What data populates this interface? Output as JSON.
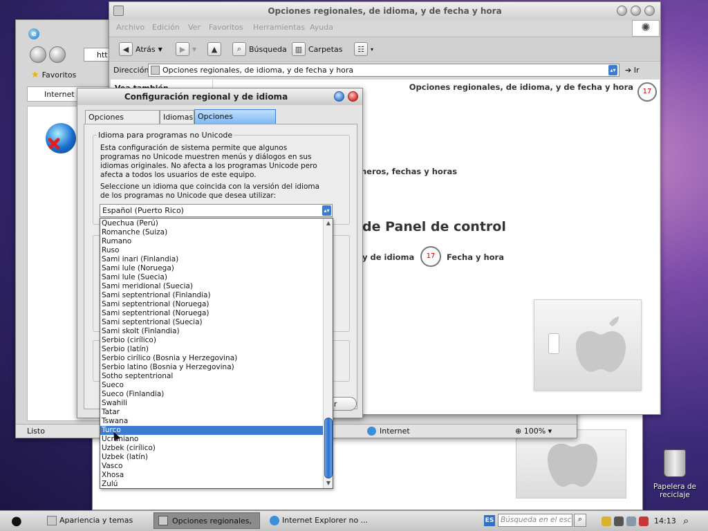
{
  "ie_window": {
    "address_partial": "htt",
    "favorites_label": "Favoritos",
    "tab_label": "Internet E",
    "status_left": "Listo",
    "zone": "Internet",
    "zoom": "100%"
  },
  "explorer": {
    "title": "Opciones regionales, de idioma, y de fecha y hora",
    "menu": [
      "Archivo",
      "Edición",
      "Ver",
      "Favoritos",
      "Herramientas",
      "Ayuda"
    ],
    "back_label": "Atrás",
    "search_label": "Búsqueda",
    "folders_label": "Carpetas",
    "address_label": "Dirección",
    "address_value": "Opciones regionales, de idioma, y de fecha y hora",
    "go_label": "Ir",
    "see_also": "Vea también",
    "header_title": "Opciones regionales, de idioma, y de fecha y hora",
    "task_text": "neros, fechas y horas",
    "panel_heading": "de Panel de control",
    "icon_lang_label": "y de idioma",
    "icon_date_label": "Fecha y hora"
  },
  "dialog": {
    "title": "Configuración regional y de idioma",
    "tabs": [
      "Opciones regionales",
      "Idiomas",
      "Opciones avanzadas"
    ],
    "group_title": "Idioma para programas no Unicode",
    "description": "Esta configuración de sistema permite que algunos programas no Unicode muestren menús y diálogos en sus idiomas originales. No afecta a los programas Unicode pero afecta a todos los usuarios de este equipo.",
    "prompt": "Seleccione un idioma que coincida con la versión del idioma de los programas no Unicode que desea utilizar:",
    "selected": "Español (Puerto Rico)",
    "options": [
      "Quechua (Perú)",
      "Romanche (Suiza)",
      "Rumano",
      "Ruso",
      "Sami inari (Finlandia)",
      "Sami lule (Noruega)",
      "Sami lule (Suecia)",
      "Sami meridional (Suecia)",
      "Sami septentrional (Finlandia)",
      "Sami septentrional (Noruega)",
      "Sami septentrional (Noruega)",
      "Sami septentrional (Suecia)",
      "Sami skolt (Finlandia)",
      "Serbio (cirílico)",
      "Serbio (latín)",
      "Serbio cirílico (Bosnia y Herzegovina)",
      "Serbio latino (Bosnia y Herzegovina)",
      "Sotho septentrional",
      "Sueco",
      "Sueco (Finlandia)",
      "Swahili",
      "Tatar",
      "Tswana",
      "Turco",
      "Ucraniano",
      "Uzbek (cirílico)",
      "Uzbek (latín)",
      "Vasco",
      "Xhosa",
      "Zulú"
    ],
    "highlighted_index": 23,
    "partial_button": "icar"
  },
  "desktop": {
    "recycle_bin": "Papelera de\nreciclaje"
  },
  "taskbar": {
    "items": [
      "Apariencia y temas",
      "Opciones regionales, ...",
      "Internet Explorer no ..."
    ],
    "lang": "ES",
    "search_placeholder": "Búsqueda en el escrito",
    "clock": "14:13"
  },
  "colors": {
    "selection": "#3d7bd1",
    "active_tab": "#7fb8ef",
    "taskbar": "#d4d4d4"
  }
}
